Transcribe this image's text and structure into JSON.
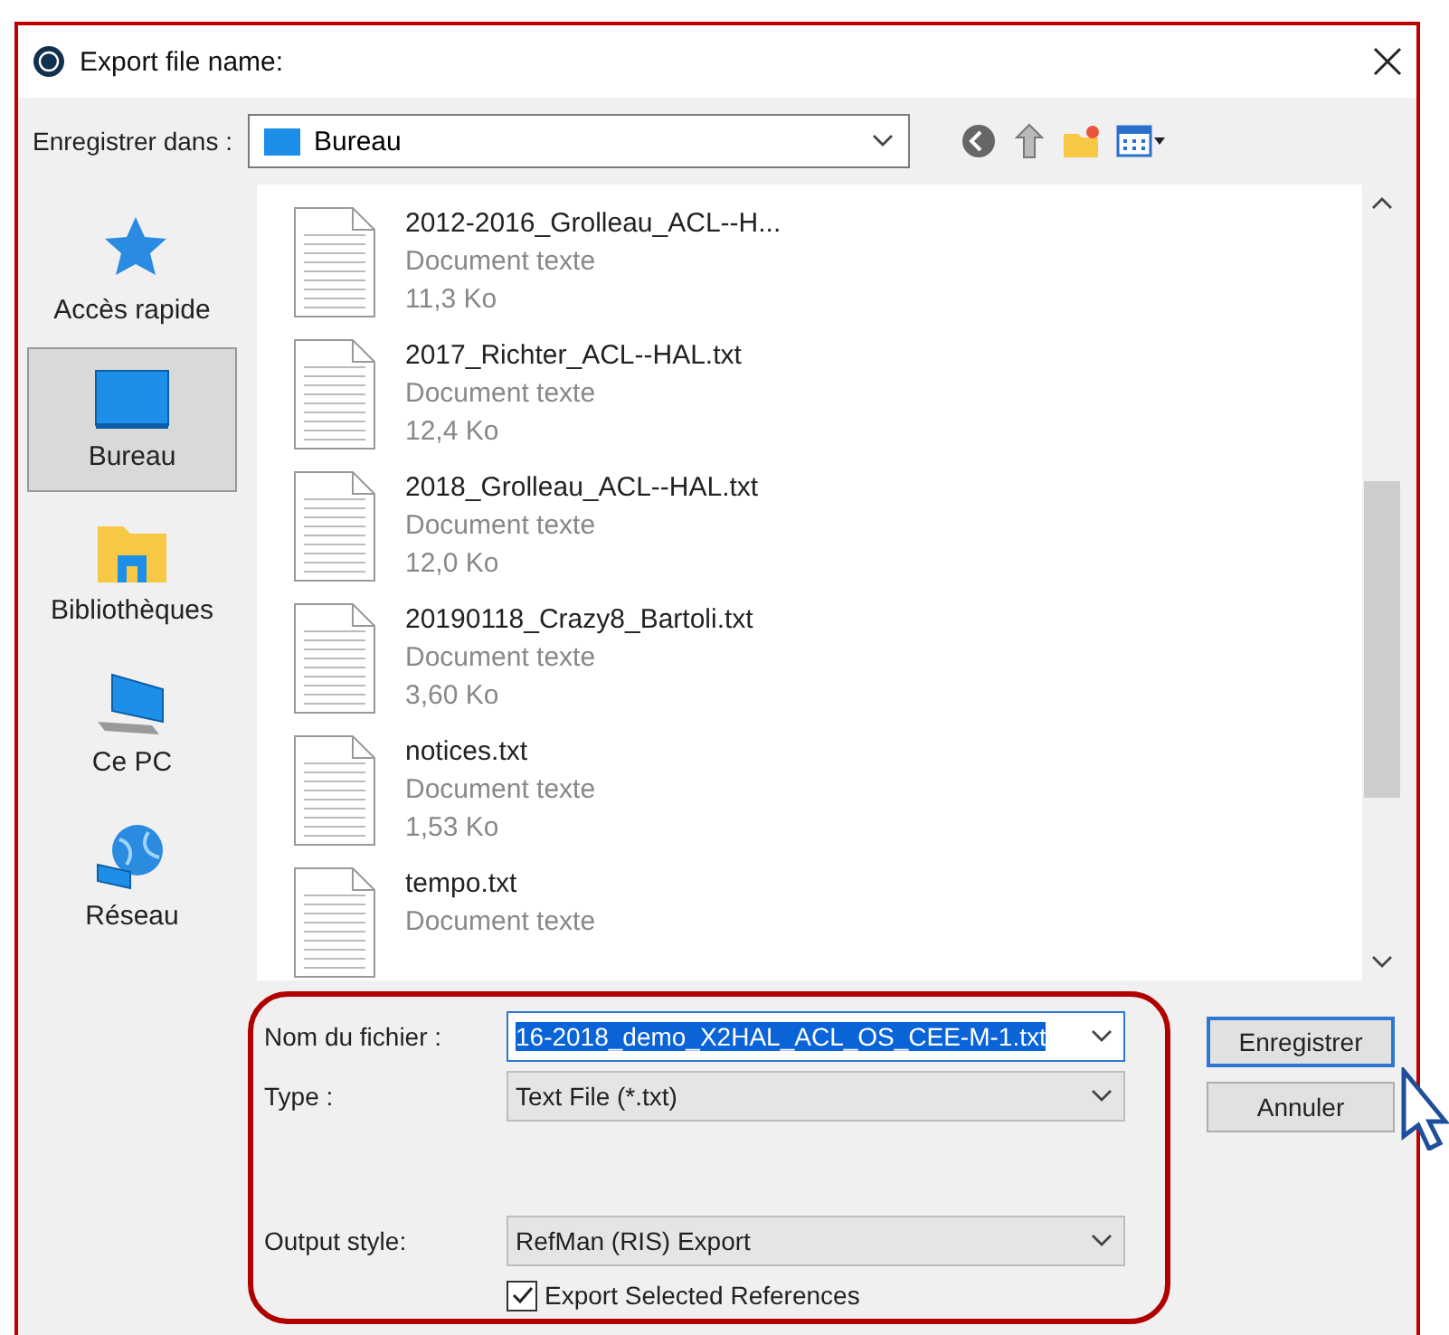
{
  "window": {
    "title": "Export file name:"
  },
  "location": {
    "label": "Enregistrer dans :",
    "value": "Bureau"
  },
  "sidebar": {
    "items": [
      {
        "label": "Accès rapide",
        "kind": "star",
        "selected": false
      },
      {
        "label": "Bureau",
        "kind": "desktop",
        "selected": true
      },
      {
        "label": "Bibliothèques",
        "kind": "library",
        "selected": false
      },
      {
        "label": "Ce PC",
        "kind": "computer",
        "selected": false
      },
      {
        "label": "Réseau",
        "kind": "network",
        "selected": false
      }
    ]
  },
  "files": [
    {
      "name": "2012-2016_Grolleau_ACL--H...",
      "type": "Document texte",
      "size": "11,3 Ko"
    },
    {
      "name": "2017_Richter_ACL--HAL.txt",
      "type": "Document texte",
      "size": "12,4 Ko"
    },
    {
      "name": "2018_Grolleau_ACL--HAL.txt",
      "type": "Document texte",
      "size": "12,0 Ko"
    },
    {
      "name": "20190118_Crazy8_Bartoli.txt",
      "type": "Document texte",
      "size": "3,60 Ko"
    },
    {
      "name": "notices.txt",
      "type": "Document texte",
      "size": "1,53 Ko"
    },
    {
      "name": "tempo.txt",
      "type": "Document texte"
    }
  ],
  "fields": [
    {
      "label": "Nom du fichier :",
      "value": "16-2018_demo_X2HAL_ACL_OS_CEE-M-1.txt",
      "kind": "text",
      "text_selected": true
    },
    {
      "label": "Type :",
      "value": "Text File (*.txt)",
      "kind": "select",
      "text_selected": false
    },
    {
      "label": "Output style:",
      "value": "RefMan (RIS) Export",
      "kind": "select",
      "text_selected": false
    }
  ],
  "checkbox": {
    "label": "Export Selected References",
    "checked": true
  },
  "buttons": [
    {
      "label": "Enregistrer",
      "default": true
    },
    {
      "label": "Annuler",
      "default": false
    }
  ]
}
